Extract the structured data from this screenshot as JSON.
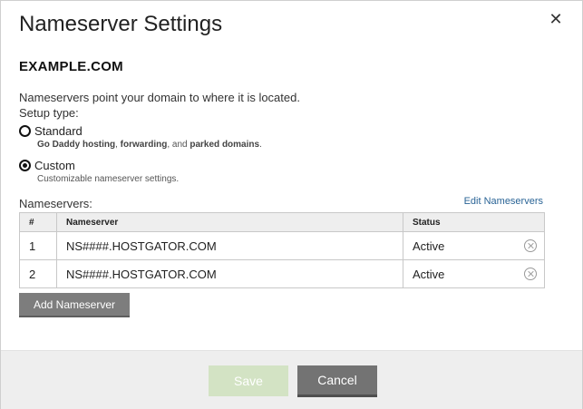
{
  "dialog": {
    "title": "Nameserver Settings",
    "close_icon": "close-icon"
  },
  "domain": "EXAMPLE.COM",
  "intro": {
    "line1": "Nameservers point your domain to where it is located.",
    "line2": "Setup type:"
  },
  "setup_types": [
    {
      "label": "Standard",
      "checked": false,
      "desc_parts": [
        "Go Daddy hosting",
        ", ",
        "forwarding",
        ", and ",
        "parked domains",
        "."
      ]
    },
    {
      "label": "Custom",
      "checked": true,
      "desc": "Customizable nameserver settings."
    }
  ],
  "nameservers": {
    "label": "Nameservers:",
    "edit_link": "Edit Nameservers",
    "columns": [
      "#",
      "Nameserver",
      "Status"
    ],
    "rows": [
      {
        "num": "1",
        "name": "NS####.HOSTGATOR.COM",
        "status": "Active"
      },
      {
        "num": "2",
        "name": "NS####.HOSTGATOR.COM",
        "status": "Active"
      }
    ],
    "add_button": "Add Nameserver"
  },
  "footer": {
    "save_label": "Save",
    "cancel_label": "Cancel"
  },
  "colors": {
    "save_disabled": "#d3e3c4",
    "cancel": "#737373",
    "link": "#2a6496"
  }
}
